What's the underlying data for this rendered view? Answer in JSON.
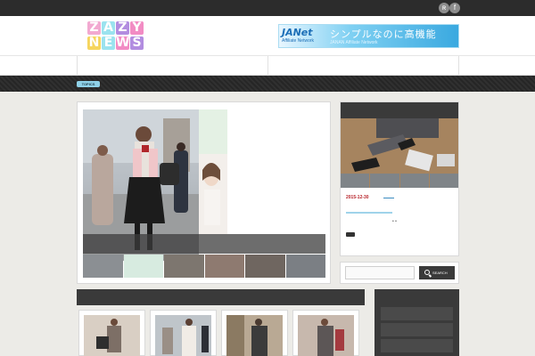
{
  "topbar": {
    "social_icons": [
      "rss-icon",
      "facebook-icon"
    ],
    "rss_glyph": "ʀ",
    "facebook_glyph": "f"
  },
  "header": {
    "logo": {
      "line1": [
        "Z",
        "A",
        "Z",
        "Y"
      ],
      "line2": [
        "N",
        "E",
        "W",
        "S"
      ],
      "colors": [
        "#f2a9d1",
        "#9be3ef",
        "#b28de0",
        "#f28cc4",
        "#f6d55e",
        "#9be3ef",
        "#f28cc4",
        "#b28de0"
      ]
    },
    "ad": {
      "brand": "JANet",
      "brand_sub": "Affiliate Network",
      "headline": "シンプルなのに高機能",
      "subline": "JANAN Affiliate Network"
    }
  },
  "topics": {
    "badge": "TOPICS",
    "badge_color": "#8fd1e8"
  },
  "sidebar": {
    "date": "2015-12-30",
    "dots": "• •"
  },
  "search": {
    "value": "",
    "button_label": "SEARCH"
  },
  "colors": {
    "dark": "#3a3a3a",
    "bg": "#ecebe7",
    "accent_red": "#b8262d",
    "accent_blue": "#9fd3ea"
  }
}
